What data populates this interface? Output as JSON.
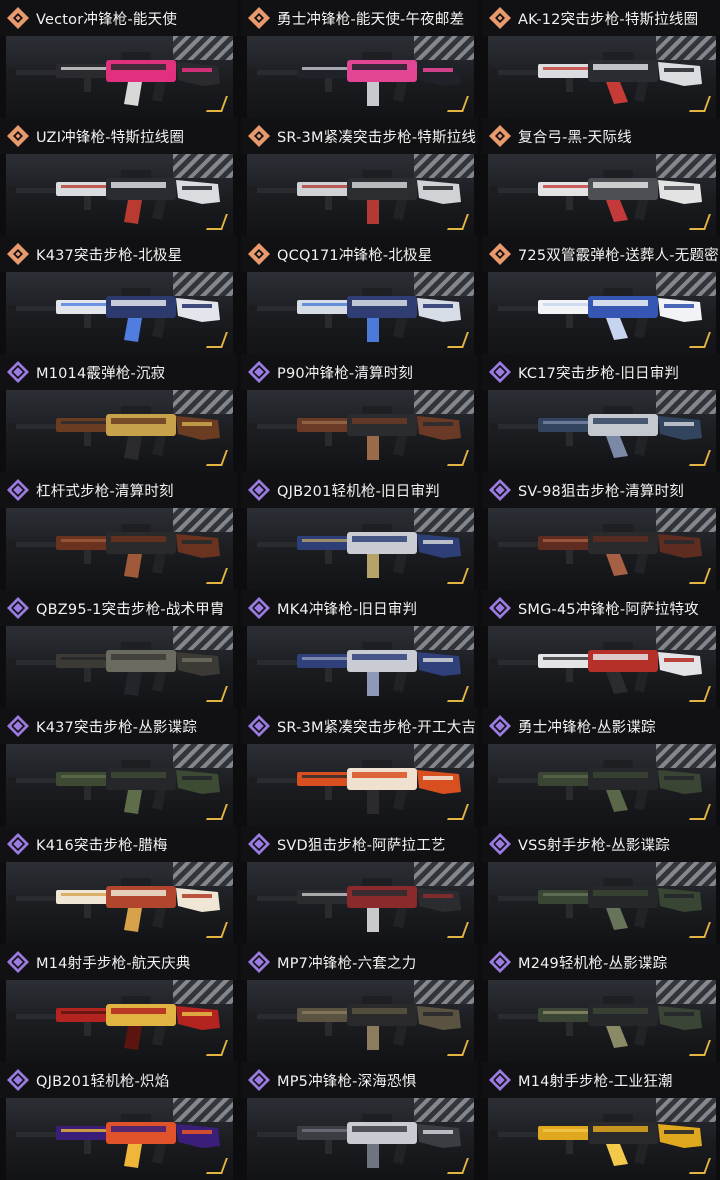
{
  "colors": {
    "legendary_icon": "#e89a6c",
    "epic_icon": "#9b7be0",
    "background": "#0d0d10",
    "title_text": "#f2f2f2"
  },
  "items": [
    {
      "title": "Vector冲锋枪-能天使",
      "rarity": "legendary",
      "palette": [
        "#2a2a2f",
        "#e0307e",
        "#d8d8d8"
      ]
    },
    {
      "title": "勇士冲锋枪-能天使-午夜邮差",
      "rarity": "legendary",
      "palette": [
        "#20222a",
        "#e34595",
        "#c7c9cf"
      ]
    },
    {
      "title": "AK-12突击步枪-特斯拉线圈",
      "rarity": "legendary",
      "palette": [
        "#d9dde0",
        "#2a2c32",
        "#c53b36"
      ]
    },
    {
      "title": "UZI冲锋枪-特斯拉线圈",
      "rarity": "legendary",
      "palette": [
        "#d9dde0",
        "#2a2c32",
        "#b83a30"
      ]
    },
    {
      "title": "SR-3M紧凑突击步枪-特斯拉线",
      "rarity": "legendary",
      "palette": [
        "#cfd3d6",
        "#2b2d31",
        "#b33a34"
      ]
    },
    {
      "title": "复合弓-黑-天际线",
      "rarity": "legendary",
      "palette": [
        "#e3e3e3",
        "#4d4f55",
        "#c43a3a"
      ]
    },
    {
      "title": "K437突击步枪-北极星",
      "rarity": "legendary",
      "palette": [
        "#e2e6ec",
        "#2c3a6e",
        "#4f7de0"
      ]
    },
    {
      "title": "QCQ171冲锋枪-北极星",
      "rarity": "legendary",
      "palette": [
        "#d7dde6",
        "#2f3d72",
        "#4b7bd8"
      ]
    },
    {
      "title": "725双管霰弹枪-送葬人-无题密",
      "rarity": "legendary",
      "palette": [
        "#f1f3f6",
        "#3656b3",
        "#c7d4f0"
      ]
    },
    {
      "title": "M1014霰弹枪-沉寂",
      "rarity": "epic",
      "palette": [
        "#6a3c22",
        "#c8a24a",
        "#2b2b2e"
      ]
    },
    {
      "title": "P90冲锋枪-清算时刻",
      "rarity": "epic",
      "palette": [
        "#6b3a26",
        "#2b2c30",
        "#9a6b4a"
      ]
    },
    {
      "title": "KC17突击步枪-旧日审判",
      "rarity": "epic",
      "palette": [
        "#33445f",
        "#c4c8cf",
        "#7b88a6"
      ]
    },
    {
      "title": "杠杆式步枪-清算时刻",
      "rarity": "epic",
      "palette": [
        "#6a3320",
        "#2a2a2c",
        "#a05a3a"
      ]
    },
    {
      "title": "QJB201轻机枪-旧日审判",
      "rarity": "epic",
      "palette": [
        "#2e3f78",
        "#c9ccd2",
        "#b7a267"
      ]
    },
    {
      "title": "SV-98狙击步枪-清算时刻",
      "rarity": "epic",
      "palette": [
        "#5e2c20",
        "#2a2a2d",
        "#a66044"
      ]
    },
    {
      "title": "QBZ95-1突击步枪-战术甲胄",
      "rarity": "epic",
      "palette": [
        "#3b3a35",
        "#6b6a5e",
        "#24252a"
      ]
    },
    {
      "title": "MK4冲锋枪-旧日审判",
      "rarity": "epic",
      "palette": [
        "#2f407a",
        "#c9ccd2",
        "#8f98b6"
      ]
    },
    {
      "title": "SMG-45冲锋枪-阿萨拉特攻",
      "rarity": "epic",
      "palette": [
        "#e4e4e6",
        "#b43028",
        "#2b2c30"
      ]
    },
    {
      "title": "K437突击步枪-丛影谍踪",
      "rarity": "epic",
      "palette": [
        "#3d4a34",
        "#25272b",
        "#5f6d4b"
      ]
    },
    {
      "title": "SR-3M紧凑突击步枪-开工大吉",
      "rarity": "epic",
      "palette": [
        "#d8501f",
        "#f0e0d0",
        "#2b2b2f"
      ]
    },
    {
      "title": "勇士冲锋枪-丛影谍踪",
      "rarity": "epic",
      "palette": [
        "#3a4533",
        "#25272b",
        "#5a6748"
      ]
    },
    {
      "title": "K416突击步枪-腊梅",
      "rarity": "epic",
      "palette": [
        "#efe6d6",
        "#b2452d",
        "#d6a24a"
      ]
    },
    {
      "title": "SVD狙击步枪-阿萨拉工艺",
      "rarity": "epic",
      "palette": [
        "#2b2c30",
        "#8a2a2c",
        "#c9c9cc"
      ]
    },
    {
      "title": "VSS射手步枪-丛影谍踪",
      "rarity": "epic",
      "palette": [
        "#3a4634",
        "#25272b",
        "#67745a"
      ]
    },
    {
      "title": "M14射手步枪-航天庆典",
      "rarity": "epic",
      "palette": [
        "#b3231f",
        "#e1b342",
        "#5b1410"
      ]
    },
    {
      "title": "MP7冲锋枪-六套之力",
      "rarity": "epic",
      "palette": [
        "#5a5342",
        "#2a2a2d",
        "#8a7c5c"
      ]
    },
    {
      "title": "M249轻机枪-丛影谍踪",
      "rarity": "epic",
      "palette": [
        "#3b4535",
        "#25272b",
        "#8b8a66"
      ]
    },
    {
      "title": "QJB201轻机枪-炽焰",
      "rarity": "epic",
      "palette": [
        "#3a1e7a",
        "#e0532a",
        "#f0b63a"
      ]
    },
    {
      "title": "MP5冲锋枪-深海恐惧",
      "rarity": "epic",
      "palette": [
        "#3b3d43",
        "#c8cbd1",
        "#6f7480"
      ]
    },
    {
      "title": "M14射手步枪-工业狂潮",
      "rarity": "epic",
      "palette": [
        "#e0a81e",
        "#2a2a2d",
        "#f2c94a"
      ]
    }
  ]
}
